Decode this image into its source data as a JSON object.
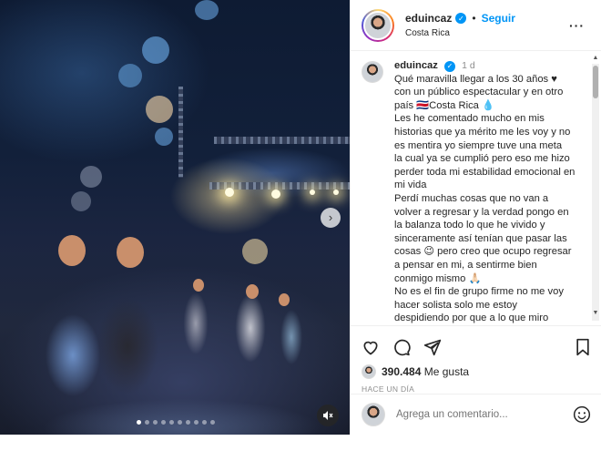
{
  "post": {
    "username": "eduincaz",
    "verified_mark": "✓",
    "separator": "•",
    "follow_label": "Seguir",
    "location": "Costa Rica",
    "more_label": "···"
  },
  "caption": {
    "username": "eduincaz",
    "time": "1 d",
    "lines": [
      "Qué maravilla llegar a los 30 años ♥",
      "con un público espectacular y en otro",
      "país 🇨🇷Costa Rica 💧",
      "Les he comentado mucho en mis",
      "historias que ya mérito me les voy y no",
      "es mentira yo siempre tuve una meta",
      "la cual ya se cumplió pero eso me hizo",
      "perder toda mi estabilidad emocional en",
      "mi vida",
      "Perdí muchas cosas que no van a",
      "volver a regresar y la verdad pongo en",
      "la balanza todo lo que he vivido y",
      "sinceramente así tenían que pasar las",
      "cosas 😉 pero creo que ocupo regresar",
      "a pensar en mi, a sentirme bien",
      "conmigo mismo 🙏🏻",
      "No es el fin de grupo firme no me voy",
      "hacer solista solo me estoy",
      "despidiendo por que a lo que miro"
    ]
  },
  "actions": {
    "like_icon": "heart-icon",
    "comment_icon": "comment-icon",
    "share_icon": "share-icon",
    "save_icon": "bookmark-icon"
  },
  "likes": {
    "count": "390.484",
    "label": "Me gusta"
  },
  "timeago": "HACE UN DÍA",
  "comment": {
    "placeholder": "Agrega un comentario..."
  },
  "carousel": {
    "next_label": "›",
    "total_slides": 10,
    "active_slide": 1
  },
  "colors": {
    "accent": "#0095f6",
    "text": "#262626",
    "muted": "#8e8e8e"
  }
}
